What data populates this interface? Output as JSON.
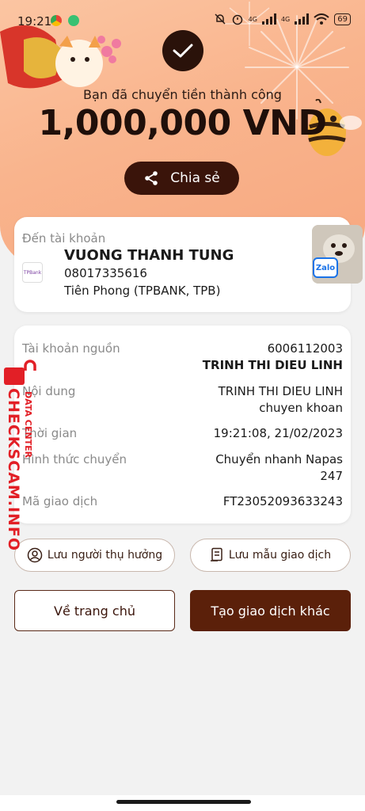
{
  "status_bar": {
    "time": "19:21",
    "battery": "69",
    "network_1": "4G",
    "network_2": "4G"
  },
  "hero": {
    "success_text": "Bạn đã chuyển tiền thành công",
    "amount": "1,000,000 VND",
    "share_label": "Chia sẻ"
  },
  "recipient": {
    "label": "Đến tài khoản",
    "name": "VUONG THANH TUNG",
    "account": "08017335616",
    "bank": "Tiên Phong (TPBANK, TPB)",
    "bank_logo_text": "TPBank"
  },
  "floating_widget": {
    "badge_label": "Zalo"
  },
  "details": {
    "source_label": "Tài khoản nguồn",
    "source_account": "6006112003",
    "source_name": "TRINH THI DIEU LINH",
    "content_label": "Nội dung",
    "content_line1": "TRINH THI DIEU LINH",
    "content_line2": "chuyen khoan",
    "time_label": "Thời gian",
    "time_value": "19:21:08, 21/02/2023",
    "method_label": "Hình thức chuyển",
    "method_line1": "Chuyển nhanh Napas",
    "method_line2": "247",
    "txn_label": "Mã giao dịch",
    "txn_value": "FT23052093633243"
  },
  "actions": {
    "save_beneficiary": "Lưu người thụ hưởng",
    "save_template": "Lưu mẫu giao dịch",
    "home": "Về trang chủ",
    "new_transaction": "Tạo giao dịch khác"
  },
  "watermark": {
    "main": "CHECKSCAM.INFO",
    "sub": "DATA CENTER"
  },
  "colors": {
    "hero_bg": "#f9b48d",
    "primary_dark": "#5b200a",
    "watermark_red": "#e21f26"
  }
}
